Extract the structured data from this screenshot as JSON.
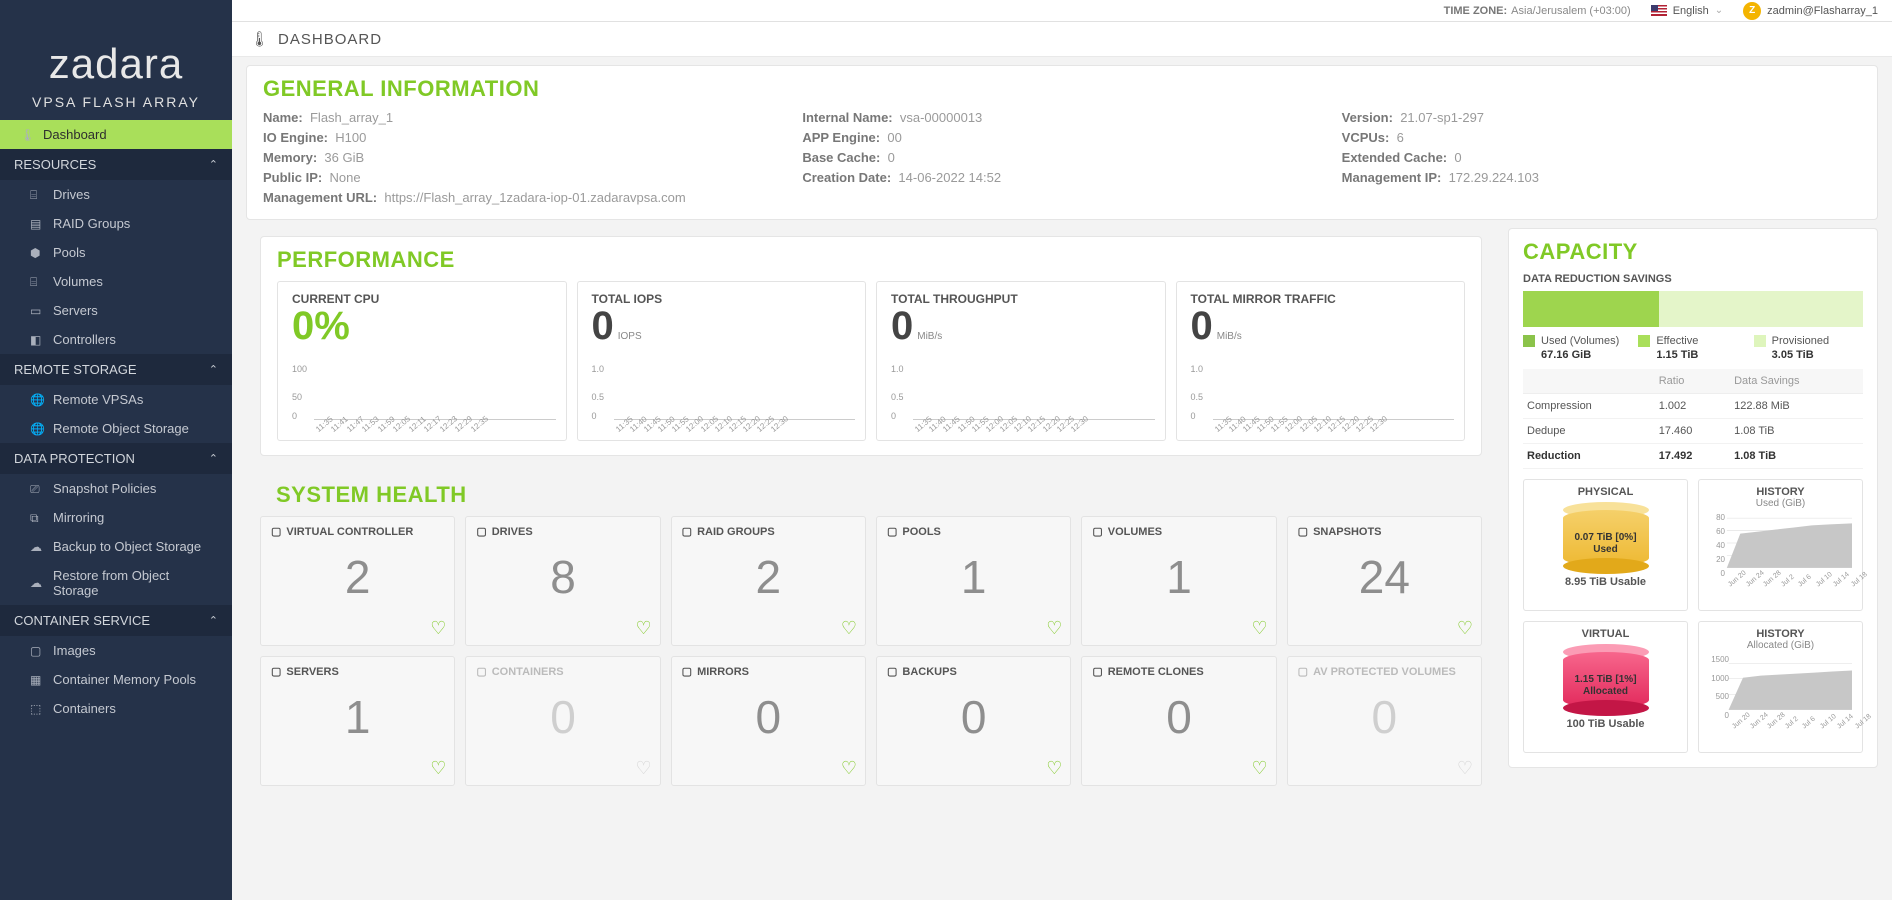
{
  "brand": "zadara",
  "product": "VPSA FLASH ARRAY",
  "nav": {
    "dashboard": "Dashboard",
    "resources": "RESOURCES",
    "drives": "Drives",
    "raid": "RAID Groups",
    "pools": "Pools",
    "volumes": "Volumes",
    "servers": "Servers",
    "controllers": "Controllers",
    "remote_storage": "REMOTE STORAGE",
    "remote_vpsas": "Remote VPSAs",
    "remote_obj": "Remote Object Storage",
    "data_prot": "DATA PROTECTION",
    "snap_pol": "Snapshot Policies",
    "mirroring": "Mirroring",
    "backup_os": "Backup to Object Storage",
    "restore_os": "Restore from Object Storage",
    "container_svc": "CONTAINER SERVICE",
    "images": "Images",
    "cmp": "Container Memory Pools",
    "containers": "Containers"
  },
  "topbar": {
    "tz_label": "TIME ZONE:",
    "tz_value": "Asia/Jerusalem (+03:00)",
    "lang": "English",
    "user": "zadmin@Flasharray_1",
    "avatar": "Z"
  },
  "page_title": "DASHBOARD",
  "general": {
    "heading": "GENERAL INFORMATION",
    "labels": {
      "name": "Name:",
      "internal": "Internal Name:",
      "version": "Version:",
      "io": "IO Engine:",
      "app": "APP Engine:",
      "vcpus": "VCPUs:",
      "memory": "Memory:",
      "basecache": "Base Cache:",
      "extcache": "Extended Cache:",
      "pubip": "Public IP:",
      "cdate": "Creation Date:",
      "mgmtip": "Management IP:",
      "mgmturl": "Management URL:"
    },
    "values": {
      "name": "Flash_array_1",
      "internal": "vsa-00000013",
      "version": "21.07-sp1-297",
      "io": "H100",
      "app": "00",
      "vcpus": "6",
      "memory": "36 GiB",
      "basecache": "0",
      "extcache": "0",
      "pubip": "None",
      "cdate": "14-06-2022 14:52",
      "mgmtip": "172.29.224.103",
      "mgmturl": "https://Flash_array_1zadara-iop-01.zadaravpsa.com"
    }
  },
  "perf": {
    "heading": "PERFORMANCE",
    "cards": [
      {
        "title": "CURRENT CPU",
        "value": "0%",
        "unit": "",
        "green": true,
        "yticks": [
          "100",
          "50",
          "0"
        ]
      },
      {
        "title": "TOTAL IOPS",
        "value": "0",
        "unit": "IOPS",
        "yticks": [
          "1.0",
          "0.5",
          "0"
        ]
      },
      {
        "title": "TOTAL THROUGHPUT",
        "value": "0",
        "unit": "MiB/s",
        "yticks": [
          "1.0",
          "0.5",
          "0"
        ]
      },
      {
        "title": "TOTAL MIRROR TRAFFIC",
        "value": "0",
        "unit": "MiB/s",
        "yticks": [
          "1.0",
          "0.5",
          "0"
        ]
      }
    ],
    "xticks": [
      "11:35",
      "11:41",
      "11:47",
      "11:53",
      "11:59",
      "12:05",
      "12:11",
      "12:17",
      "12:23",
      "12:29",
      "12:35"
    ],
    "xticks2": [
      "11:35",
      "11:40",
      "11:45",
      "11:50",
      "11:55",
      "12:00",
      "12:05",
      "12:10",
      "12:15",
      "12:20",
      "12:25",
      "12:30"
    ]
  },
  "health": {
    "heading": "SYSTEM HEALTH",
    "cards": [
      {
        "title": "VIRTUAL CONTROLLER",
        "value": "2",
        "disabled": false
      },
      {
        "title": "DRIVES",
        "value": "8",
        "disabled": false
      },
      {
        "title": "RAID GROUPS",
        "value": "2",
        "disabled": false
      },
      {
        "title": "POOLS",
        "value": "1",
        "disabled": false
      },
      {
        "title": "VOLUMES",
        "value": "1",
        "disabled": false
      },
      {
        "title": "SNAPSHOTS",
        "value": "24",
        "disabled": false
      },
      {
        "title": "SERVERS",
        "value": "1",
        "disabled": false
      },
      {
        "title": "CONTAINERS",
        "value": "0",
        "disabled": true
      },
      {
        "title": "MIRRORS",
        "value": "0",
        "disabled": false
      },
      {
        "title": "BACKUPS",
        "value": "0",
        "disabled": false
      },
      {
        "title": "REMOTE CLONES",
        "value": "0",
        "disabled": false
      },
      {
        "title": "AV PROTECTED VOLUMES",
        "value": "0",
        "disabled": true
      }
    ]
  },
  "capacity": {
    "heading": "CAPACITY",
    "dr_label": "DATA REDUCTION SAVINGS",
    "legend": [
      {
        "name": "Used (Volumes)",
        "color": "#8bc34a",
        "value": "67.16 GiB"
      },
      {
        "name": "Effective",
        "color": "#a9df5a",
        "value": "1.15 TiB"
      },
      {
        "name": "Provisioned",
        "color": "#def5bc",
        "value": "3.05 TiB"
      }
    ],
    "ratio_headers": [
      "",
      "Ratio",
      "Data Savings"
    ],
    "ratios": [
      {
        "name": "Compression",
        "ratio": "1.002",
        "save": "122.88 MiB"
      },
      {
        "name": "Dedupe",
        "ratio": "17.460",
        "save": "1.08 TiB"
      },
      {
        "name": "Reduction",
        "ratio": "17.492",
        "save": "1.08 TiB",
        "total": true
      }
    ],
    "physical": {
      "title": "PHYSICAL",
      "label_l1": "0.07 TiB [0%]",
      "label_l2": "Used",
      "sub": "8.95 TiB Usable"
    },
    "virtual": {
      "title": "VIRTUAL",
      "label_l1": "1.15 TiB [1%]",
      "label_l2": "Allocated",
      "sub": "100 TiB Usable"
    },
    "hist1": {
      "title": "HISTORY",
      "sub": "Used (GiB)",
      "yticks": [
        "80",
        "60",
        "40",
        "20",
        "0"
      ],
      "xticks": [
        "Jun 20",
        "Jun 24",
        "Jun 28",
        "Jul 2",
        "Jul 6",
        "Jul 10",
        "Jul 14",
        "Jul 18"
      ]
    },
    "hist2": {
      "title": "HISTORY",
      "sub": "Allocated (GiB)",
      "yticks": [
        "1500",
        "1000",
        "500",
        "0"
      ],
      "xticks": [
        "Jun 20",
        "Jun 24",
        "Jun 28",
        "Jul 2",
        "Jul 6",
        "Jul 10",
        "Jul 14",
        "Jul 18"
      ]
    }
  },
  "chart_data": [
    {
      "type": "line",
      "title": "CURRENT CPU",
      "ylabel": "%",
      "ylim": [
        0,
        100
      ],
      "x": [
        "11:35",
        "11:41",
        "11:47",
        "11:53",
        "11:59",
        "12:05",
        "12:11",
        "12:17",
        "12:23",
        "12:29",
        "12:35"
      ],
      "values": [
        0,
        0,
        0,
        0,
        0,
        0,
        0,
        0,
        0,
        0,
        0
      ]
    },
    {
      "type": "line",
      "title": "TOTAL IOPS",
      "ylabel": "IOPS",
      "ylim": [
        0,
        1.0
      ],
      "x": [
        "11:35",
        "11:40",
        "11:45",
        "11:50",
        "11:55",
        "12:00",
        "12:05",
        "12:10",
        "12:15",
        "12:20",
        "12:25",
        "12:30"
      ],
      "values": [
        0,
        0,
        0,
        0,
        0,
        0,
        0,
        0,
        0,
        0,
        0,
        0
      ]
    },
    {
      "type": "line",
      "title": "TOTAL THROUGHPUT",
      "ylabel": "MiB/s",
      "ylim": [
        0,
        1.0
      ],
      "x": [
        "11:35",
        "11:40",
        "11:45",
        "11:50",
        "11:55",
        "12:00",
        "12:05",
        "12:10",
        "12:15",
        "12:20",
        "12:25",
        "12:30"
      ],
      "values": [
        0,
        0,
        0,
        0,
        0,
        0,
        0,
        0,
        0,
        0,
        0,
        0
      ]
    },
    {
      "type": "line",
      "title": "TOTAL MIRROR TRAFFIC",
      "ylabel": "MiB/s",
      "ylim": [
        0,
        1.0
      ],
      "x": [
        "11:35",
        "11:40",
        "11:45",
        "11:50",
        "11:55",
        "12:00",
        "12:05",
        "12:10",
        "12:15",
        "12:20",
        "12:25",
        "12:30"
      ],
      "values": [
        0,
        0,
        0,
        0,
        0,
        0,
        0,
        0,
        0,
        0,
        0,
        0
      ]
    },
    {
      "type": "area",
      "title": "HISTORY Used (GiB)",
      "ylabel": "GiB",
      "ylim": [
        0,
        80
      ],
      "x": [
        "Jun 20",
        "Jun 24",
        "Jun 28",
        "Jul 2",
        "Jul 6",
        "Jul 10",
        "Jul 14",
        "Jul 18"
      ],
      "values": [
        0,
        50,
        55,
        57,
        60,
        63,
        65,
        67
      ]
    },
    {
      "type": "area",
      "title": "HISTORY Allocated (GiB)",
      "ylabel": "GiB",
      "ylim": [
        0,
        1500
      ],
      "x": [
        "Jun 20",
        "Jun 24",
        "Jun 28",
        "Jul 2",
        "Jul 6",
        "Jul 10",
        "Jul 14",
        "Jul 18"
      ],
      "values": [
        0,
        1000,
        1050,
        1100,
        1120,
        1140,
        1150,
        1180
      ]
    }
  ]
}
